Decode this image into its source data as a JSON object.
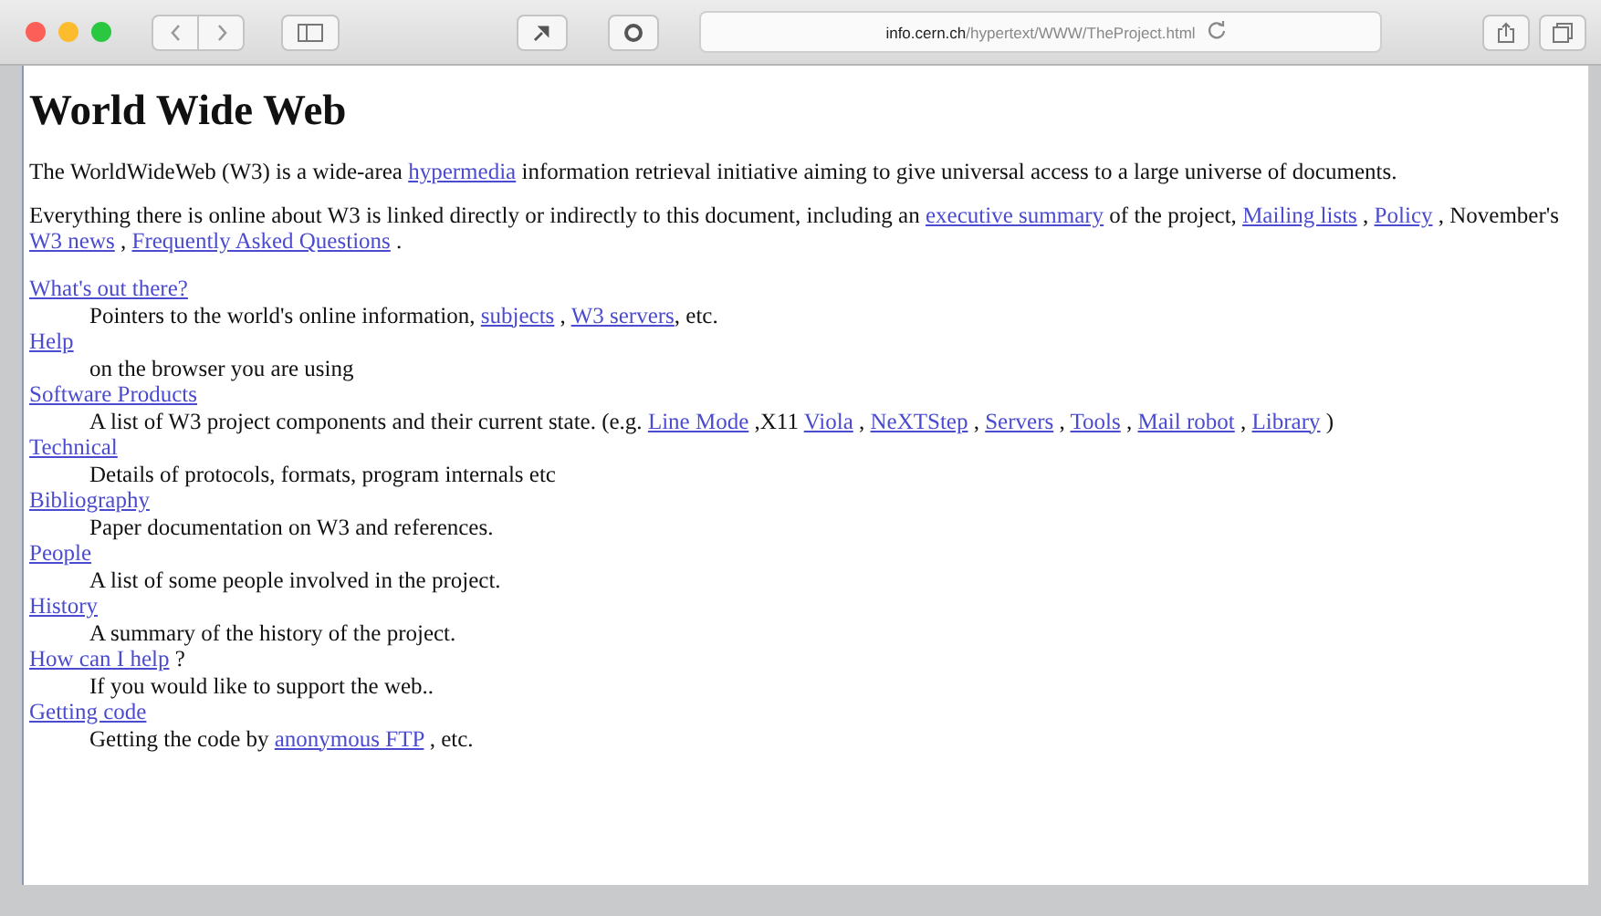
{
  "browser": {
    "address_host": "info.cern.ch",
    "address_path": "/hypertext/WWW/TheProject.html"
  },
  "page": {
    "title": "World Wide Web",
    "paragraphs": [
      [
        [
          {
            "kind": "text",
            "text": "The WorldWideWeb (W3) is a wide-area "
          },
          {
            "kind": "link",
            "text": "hypermedia"
          },
          {
            "kind": "text",
            "text": " information retrieval initiative aiming to give universal access to a large universe of documents."
          }
        ]
      ],
      [
        [
          {
            "kind": "text",
            "text": "Everything there is online about W3 is linked directly or indirectly to this document, including an "
          },
          {
            "kind": "link",
            "text": "executive summary"
          },
          {
            "kind": "text",
            "text": " of the project, "
          },
          {
            "kind": "link",
            "text": "Mailing lists"
          },
          {
            "kind": "text",
            "text": " , "
          },
          {
            "kind": "link",
            "text": "Policy"
          },
          {
            "kind": "text",
            "text": " , November's"
          }
        ],
        [
          {
            "kind": "link",
            "text": "W3 news"
          },
          {
            "kind": "text",
            "text": " , "
          },
          {
            "kind": "link",
            "text": "Frequently Asked Questions"
          },
          {
            "kind": "text",
            "text": " ."
          }
        ]
      ]
    ],
    "definitions": [
      {
        "term": [
          {
            "kind": "link",
            "text": "What's out there?"
          }
        ],
        "description": [
          {
            "kind": "text",
            "text": "Pointers to the world's online information, "
          },
          {
            "kind": "link",
            "text": "subjects"
          },
          {
            "kind": "text",
            "text": " , "
          },
          {
            "kind": "link",
            "text": "W3 servers"
          },
          {
            "kind": "text",
            "text": ", etc."
          }
        ]
      },
      {
        "term": [
          {
            "kind": "link",
            "text": "Help"
          }
        ],
        "description": [
          {
            "kind": "text",
            "text": "on the browser you are using"
          }
        ]
      },
      {
        "term": [
          {
            "kind": "link",
            "text": "Software Products"
          }
        ],
        "description": [
          {
            "kind": "text",
            "text": "A list of W3 project components and their current state. (e.g. "
          },
          {
            "kind": "link",
            "text": "Line Mode"
          },
          {
            "kind": "text",
            "text": " ,X11 "
          },
          {
            "kind": "link",
            "text": "Viola"
          },
          {
            "kind": "text",
            "text": " , "
          },
          {
            "kind": "link",
            "text": "NeXTStep"
          },
          {
            "kind": "text",
            "text": " , "
          },
          {
            "kind": "link",
            "text": "Servers"
          },
          {
            "kind": "text",
            "text": " , "
          },
          {
            "kind": "link",
            "text": "Tools"
          },
          {
            "kind": "text",
            "text": " , "
          },
          {
            "kind": "link",
            "text": "Mail robot"
          },
          {
            "kind": "text",
            "text": " , "
          },
          {
            "kind": "link",
            "text": "Library"
          },
          {
            "kind": "text",
            "text": " )"
          }
        ]
      },
      {
        "term": [
          {
            "kind": "link",
            "text": "Technical"
          }
        ],
        "description": [
          {
            "kind": "text",
            "text": "Details of protocols, formats, program internals etc"
          }
        ]
      },
      {
        "term": [
          {
            "kind": "link",
            "text": "Bibliography"
          }
        ],
        "description": [
          {
            "kind": "text",
            "text": "Paper documentation on W3 and references."
          }
        ]
      },
      {
        "term": [
          {
            "kind": "link",
            "text": "People"
          }
        ],
        "description": [
          {
            "kind": "text",
            "text": "A list of some people involved in the project."
          }
        ]
      },
      {
        "term": [
          {
            "kind": "link",
            "text": "History"
          }
        ],
        "description": [
          {
            "kind": "text",
            "text": "A summary of the history of the project."
          }
        ]
      },
      {
        "term": [
          {
            "kind": "link",
            "text": "How can I help"
          },
          {
            "kind": "text",
            "text": " ?"
          }
        ],
        "description": [
          {
            "kind": "text",
            "text": "If you would like to support the web.."
          }
        ]
      },
      {
        "term": [
          {
            "kind": "link",
            "text": "Getting code"
          }
        ],
        "description": [
          {
            "kind": "text",
            "text": "Getting the code by "
          },
          {
            "kind": "link",
            "text": "anonymous FTP"
          },
          {
            "kind": "text",
            "text": " , etc."
          }
        ]
      }
    ]
  }
}
